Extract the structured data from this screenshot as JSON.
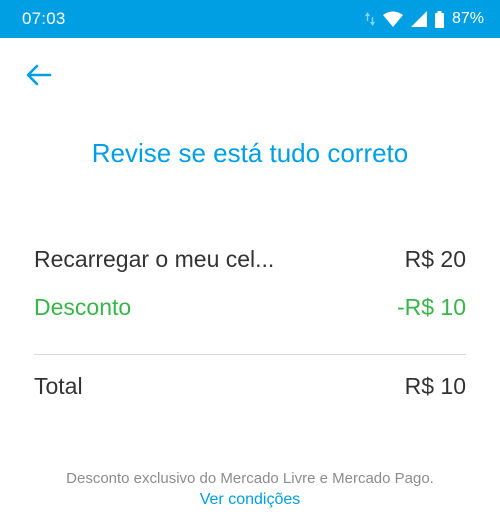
{
  "status_bar": {
    "time": "07:03",
    "battery": "87%",
    "icons": [
      "data-arrows-icon",
      "wifi-icon",
      "signal-icon",
      "battery-icon"
    ]
  },
  "header": {
    "back_icon": "arrow-left-icon",
    "title": "Revise se está tudo correto"
  },
  "summary": {
    "item_label": "Recarregar o meu cel...",
    "item_value": "R$ 20",
    "discount_label": "Desconto",
    "discount_value": "-R$ 10",
    "total_label": "Total",
    "total_value": "R$ 10"
  },
  "footer": {
    "disclaimer": "Desconto exclusivo do Mercado Livre e Mercado Pago.",
    "link": "Ver condições"
  },
  "colors": {
    "accent": "#009ee3",
    "discount": "#39b54a",
    "text": "#333333",
    "muted": "#8c8c8c"
  }
}
